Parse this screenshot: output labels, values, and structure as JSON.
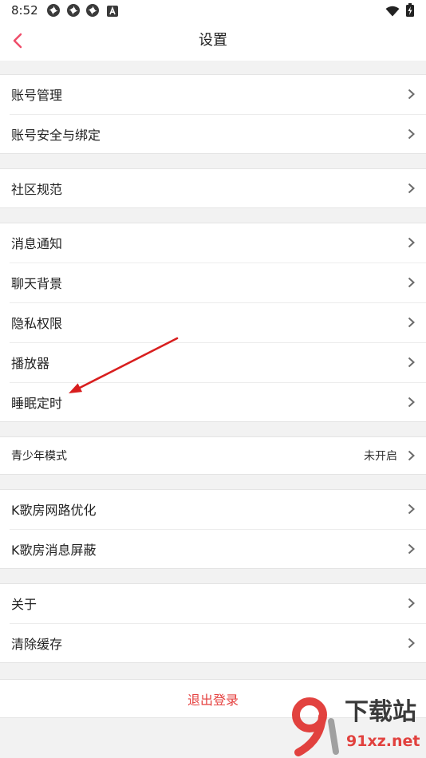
{
  "status_bar": {
    "time": "8:52",
    "icons": [
      "aperture-icon",
      "aperture-icon",
      "aperture-icon",
      "a-box-icon",
      "wifi-icon",
      "battery-icon"
    ]
  },
  "header": {
    "title": "设置",
    "back_icon": "chevron-left-icon"
  },
  "row_icon": "chevron-right-icon",
  "groups": [
    {
      "items": [
        {
          "label": "账号管理"
        },
        {
          "label": "账号安全与绑定"
        }
      ]
    },
    {
      "items": [
        {
          "label": "社区规范"
        }
      ]
    },
    {
      "items": [
        {
          "label": "消息通知"
        },
        {
          "label": "聊天背景"
        },
        {
          "label": "隐私权限"
        },
        {
          "label": "播放器"
        },
        {
          "label": "睡眠定时"
        }
      ]
    },
    {
      "items": [
        {
          "label": "青少年模式",
          "value": "未开启"
        }
      ]
    },
    {
      "items": [
        {
          "label": "K歌房网路优化"
        },
        {
          "label": "K歌房消息屏蔽"
        }
      ]
    },
    {
      "items": [
        {
          "label": "关于"
        },
        {
          "label": "清除缓存"
        }
      ]
    }
  ],
  "logout": {
    "label": "退出登录"
  },
  "watermark": {
    "brand": "下载站",
    "site": "91xz.net"
  },
  "colors": {
    "accent": "#ef4d6a",
    "logout_text": "#e5403f",
    "annotation_arrow": "#d81e1e",
    "background": "#f2f2f2",
    "row_text": "#222222",
    "chevron": "#6b6b6b",
    "watermark_red": "#e0332f"
  }
}
